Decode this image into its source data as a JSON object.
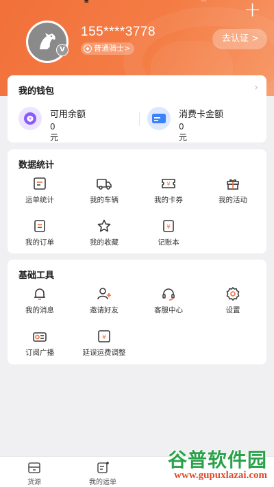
{
  "status_fragments": "📱 %",
  "header": {
    "phone": "155****3778",
    "avatar_badge": "V",
    "level": "普通骑士>",
    "verify_button": "去认证 >",
    "add_icon": "plus-icon"
  },
  "wallet": {
    "title": "我的钱包",
    "chevron": "›",
    "items": [
      {
        "label": "可用余额",
        "value": "0元",
        "icon": "money-bag-icon",
        "color": "#8b5cf6"
      },
      {
        "label": "消费卡金额",
        "value": "0元",
        "icon": "card-icon",
        "color": "#3b82f6"
      }
    ]
  },
  "stats": {
    "title": "数据统计",
    "items": [
      {
        "label": "运单统计",
        "icon": "waybill-stats-icon"
      },
      {
        "label": "我的车辆",
        "icon": "truck-icon"
      },
      {
        "label": "我的卡券",
        "icon": "coupon-icon"
      },
      {
        "label": "我的活动",
        "icon": "gift-icon"
      },
      {
        "label": "我的订单",
        "icon": "order-icon"
      },
      {
        "label": "我的收藏",
        "icon": "star-icon"
      },
      {
        "label": "记账本",
        "icon": "ledger-icon"
      }
    ]
  },
  "tools": {
    "title": "基础工具",
    "items": [
      {
        "label": "我的消息",
        "icon": "bell-icon"
      },
      {
        "label": "邀请好友",
        "icon": "add-user-icon"
      },
      {
        "label": "客服中心",
        "icon": "headset-icon"
      },
      {
        "label": "设置",
        "icon": "gear-icon"
      },
      {
        "label": "订阅广播",
        "icon": "radio-icon"
      },
      {
        "label": "延误运费调整",
        "icon": "fee-adjust-icon"
      }
    ]
  },
  "tabbar": {
    "tabs": [
      {
        "label": "货源",
        "icon": "cargo-icon"
      },
      {
        "label": "我的运单",
        "icon": "waybill-icon"
      }
    ]
  },
  "watermark": {
    "title": "谷普软件园",
    "url": "www.gupuxlazai.com"
  },
  "colors": {
    "accent": "#f2703a",
    "icon_stroke": "#3a3a3a",
    "icon_accent": "#f2703a"
  }
}
